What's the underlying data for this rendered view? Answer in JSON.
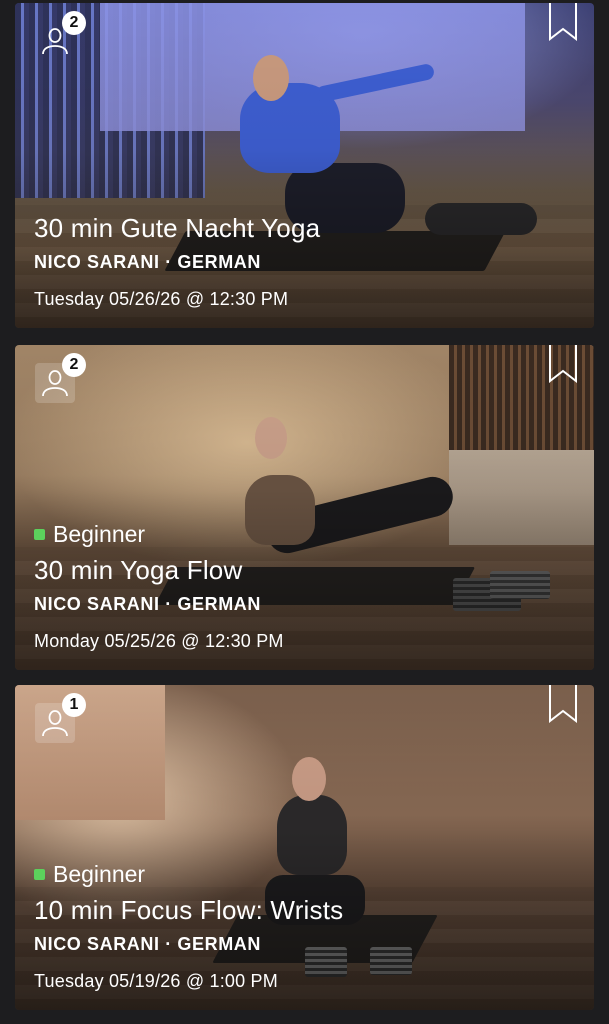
{
  "classes": [
    {
      "participants": "2",
      "level": "",
      "title": "30 min Gute Nacht Yoga",
      "instructor": "NICO SARANI · GERMAN",
      "datetime": "Tuesday 05/26/26 @ 12:30 PM"
    },
    {
      "participants": "2",
      "level": "Beginner",
      "title": "30 min Yoga Flow",
      "instructor": "NICO SARANI · GERMAN",
      "datetime": "Monday 05/25/26 @ 12:30 PM"
    },
    {
      "participants": "1",
      "level": "Beginner",
      "title": "10 min Focus Flow: Wrists",
      "instructor": "NICO SARANI · GERMAN",
      "datetime": "Tuesday 05/19/26 @ 1:00 PM"
    }
  ],
  "icons": {
    "participants": "person-icon",
    "bookmark": "bookmark-icon"
  },
  "colors": {
    "background": "#1d1d1f",
    "beginner_dot": "#5cd15c",
    "text": "#ffffff"
  }
}
